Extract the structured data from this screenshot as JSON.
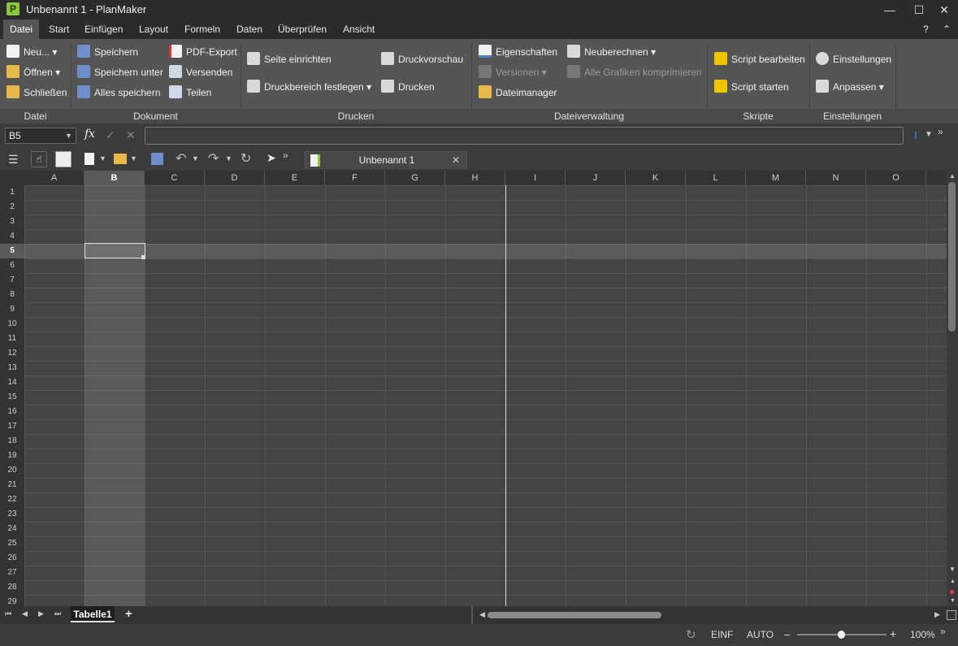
{
  "window": {
    "title": "Unbenannt 1 - PlanMaker",
    "logo_letter": "P"
  },
  "menu": {
    "tabs": [
      {
        "label": "Datei"
      },
      {
        "label": "Start"
      },
      {
        "label": "Einfügen"
      },
      {
        "label": "Layout"
      },
      {
        "label": "Formeln"
      },
      {
        "label": "Daten"
      },
      {
        "label": "Überprüfen"
      },
      {
        "label": "Ansicht"
      }
    ],
    "help": "?"
  },
  "ribbon": {
    "datei": {
      "neu": "Neu...",
      "oeffnen": "Öffnen",
      "schliessen": "Schließen",
      "group": "Datei"
    },
    "dokument": {
      "speichern": "Speichern",
      "speichern_unter": "Speichern unter",
      "alles_speichern": "Alles speichern",
      "pdf_export": "PDF-Export",
      "versenden": "Versenden",
      "teilen": "Teilen",
      "group": "Dokument"
    },
    "drucken": {
      "seite_einrichten": "Seite einrichten",
      "druckbereich": "Druckbereich festlegen",
      "druckvorschau": "Druckvorschau",
      "drucken": "Drucken",
      "group": "Drucken"
    },
    "dateiverwaltung": {
      "eigenschaften": "Eigenschaften",
      "versionen": "Versionen",
      "dateimanager": "Dateimanager",
      "neuberechnen": "Neuberechnen",
      "alle_grafiken": "Alle Grafiken komprimieren",
      "group": "Dateiverwaltung"
    },
    "skripte": {
      "script_bearbeiten": "Script bearbeiten",
      "script_starten": "Script starten",
      "group": "Skripte"
    },
    "einstellungen": {
      "einstellungen": "Einstellungen",
      "anpassen": "Anpassen",
      "group": "Einstellungen"
    }
  },
  "formula": {
    "cell_ref": "B5",
    "fx": "fx",
    "value": ""
  },
  "document_tab": {
    "label": "Unbenannt 1"
  },
  "grid": {
    "columns": [
      "A",
      "B",
      "C",
      "D",
      "E",
      "F",
      "G",
      "H",
      "I",
      "J",
      "K",
      "L",
      "M",
      "N",
      "O"
    ],
    "rows": [
      "1",
      "2",
      "3",
      "4",
      "5",
      "6",
      "7",
      "8",
      "9",
      "10",
      "11",
      "12",
      "13",
      "14",
      "15",
      "16",
      "17",
      "18",
      "19",
      "20",
      "21",
      "22",
      "23",
      "24",
      "25",
      "26",
      "27",
      "28",
      "29"
    ],
    "selected_cell": "B5"
  },
  "sheets": [
    {
      "label": "Tabelle1"
    }
  ],
  "sheet_add": "+",
  "status": {
    "mode1": "EINF",
    "mode2": "AUTO",
    "zoom": "100%",
    "zoom_minus": "–",
    "zoom_plus": "+",
    "zoom_fraction": 0.5
  },
  "colors": {
    "accent": "#8cc63f",
    "selection_border": "#dddddd"
  }
}
